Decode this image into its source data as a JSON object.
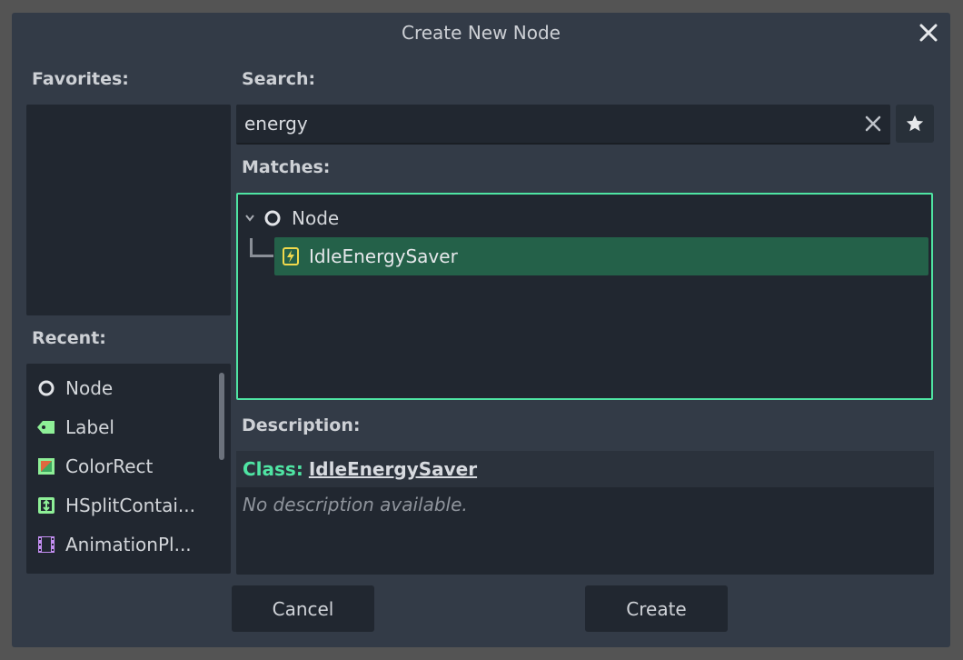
{
  "dialog": {
    "title": "Create New Node"
  },
  "labels": {
    "favorites": "Favorites:",
    "recent": "Recent:",
    "search": "Search:",
    "matches": "Matches:",
    "description": "Description:"
  },
  "search": {
    "value": "energy"
  },
  "recent": {
    "items": [
      {
        "label": "Node",
        "icon": "node-circle-icon"
      },
      {
        "label": "Label",
        "icon": "label-tag-icon"
      },
      {
        "label": "ColorRect",
        "icon": "color-rect-icon"
      },
      {
        "label": "HSplitContai...",
        "icon": "hsplit-container-icon"
      },
      {
        "label": "AnimationPl...",
        "icon": "animation-player-icon"
      }
    ]
  },
  "matches": {
    "root": {
      "label": "Node",
      "icon": "node-circle-icon"
    },
    "child": {
      "label": "IdleEnergySaver",
      "icon": "energy-bolt-icon",
      "selected": true
    }
  },
  "description": {
    "class_prefix": "Class:",
    "class_name": "IdleEnergySaver",
    "text": "No description available."
  },
  "buttons": {
    "cancel": "Cancel",
    "create": "Create"
  },
  "colors": {
    "accent": "#4fe4a3",
    "selection": "#246149",
    "panel": "#212730",
    "dialog": "#333b47"
  }
}
